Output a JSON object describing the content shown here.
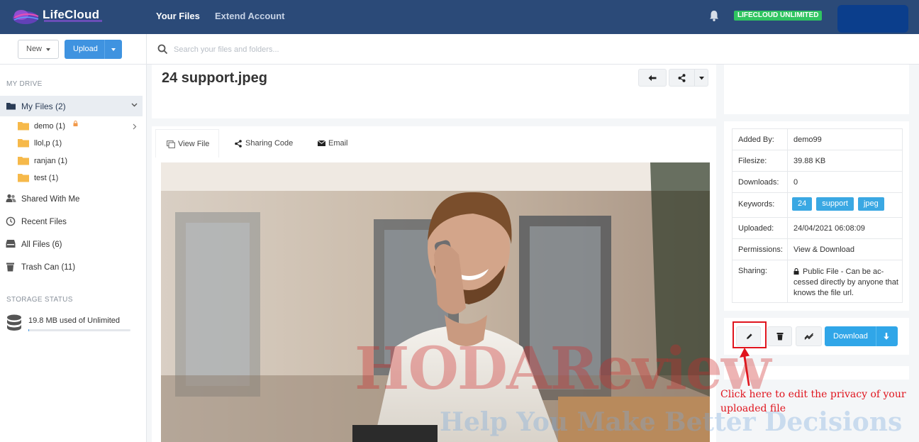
{
  "app": {
    "name": "LifeCloud",
    "plan_badge": "LIFECLOUD UNLIMITED"
  },
  "nav": {
    "items": [
      {
        "label": "Your Files",
        "active": true
      },
      {
        "label": "Extend Account",
        "active": false
      }
    ]
  },
  "toolbar": {
    "new_label": "New",
    "upload_label": "Upload"
  },
  "search": {
    "placeholder": "Search your files and folders..."
  },
  "sidebar": {
    "drive_heading": "MY DRIVE",
    "my_files": "My Files (2)",
    "folders": [
      {
        "label": "demo (1)"
      },
      {
        "label": "llol,p (1)"
      },
      {
        "label": "ranjan (1)"
      },
      {
        "label": "test (1)"
      }
    ],
    "items": [
      {
        "label": "Shared With Me",
        "icon": "users-icon"
      },
      {
        "label": "Recent Files",
        "icon": "clock-icon"
      },
      {
        "label": "All Files (6)",
        "icon": "archive-icon"
      },
      {
        "label": "Trash Can (11)",
        "icon": "trash-icon"
      }
    ],
    "storage_heading": "STORAGE STATUS",
    "storage_text": "19.8 MB used of Unlimited"
  },
  "file": {
    "title": "24 support.jpeg",
    "tabs": [
      {
        "label": "View File",
        "active": true
      },
      {
        "label": "Sharing Code",
        "active": false
      },
      {
        "label": "Email",
        "active": false
      }
    ]
  },
  "details": {
    "rows": [
      {
        "key": "Added By:",
        "value": "demo99"
      },
      {
        "key": "Filesize:",
        "value": "39.88 KB"
      },
      {
        "key": "Downloads:",
        "value": "0"
      },
      {
        "key": "Keywords:",
        "tags": [
          "24",
          "support",
          "jpeg"
        ]
      },
      {
        "key": "Uploaded:",
        "value": "24/04/2021 06:08:09"
      },
      {
        "key": "Permissions:",
        "value": "View & Download"
      },
      {
        "key": "Sharing:",
        "value_lines": [
          "Public File - Can be ac-",
          "cessed directly by anyone that",
          "knows the file url."
        ]
      }
    ]
  },
  "actions": {
    "download_label": "Download"
  },
  "annotation": {
    "lines": [
      "Click here to edit the privacy of your",
      "uploaded file"
    ]
  },
  "watermark": {
    "brand": "HODAReview",
    "tagline": "Help You Make Better Decisions"
  },
  "colors": {
    "topbar": "#2b4a78",
    "primary": "#3f93e0",
    "download": "#30a6e8",
    "tag": "#3aa8e3",
    "badge": "#30c461",
    "annotation": "#e0141d"
  }
}
